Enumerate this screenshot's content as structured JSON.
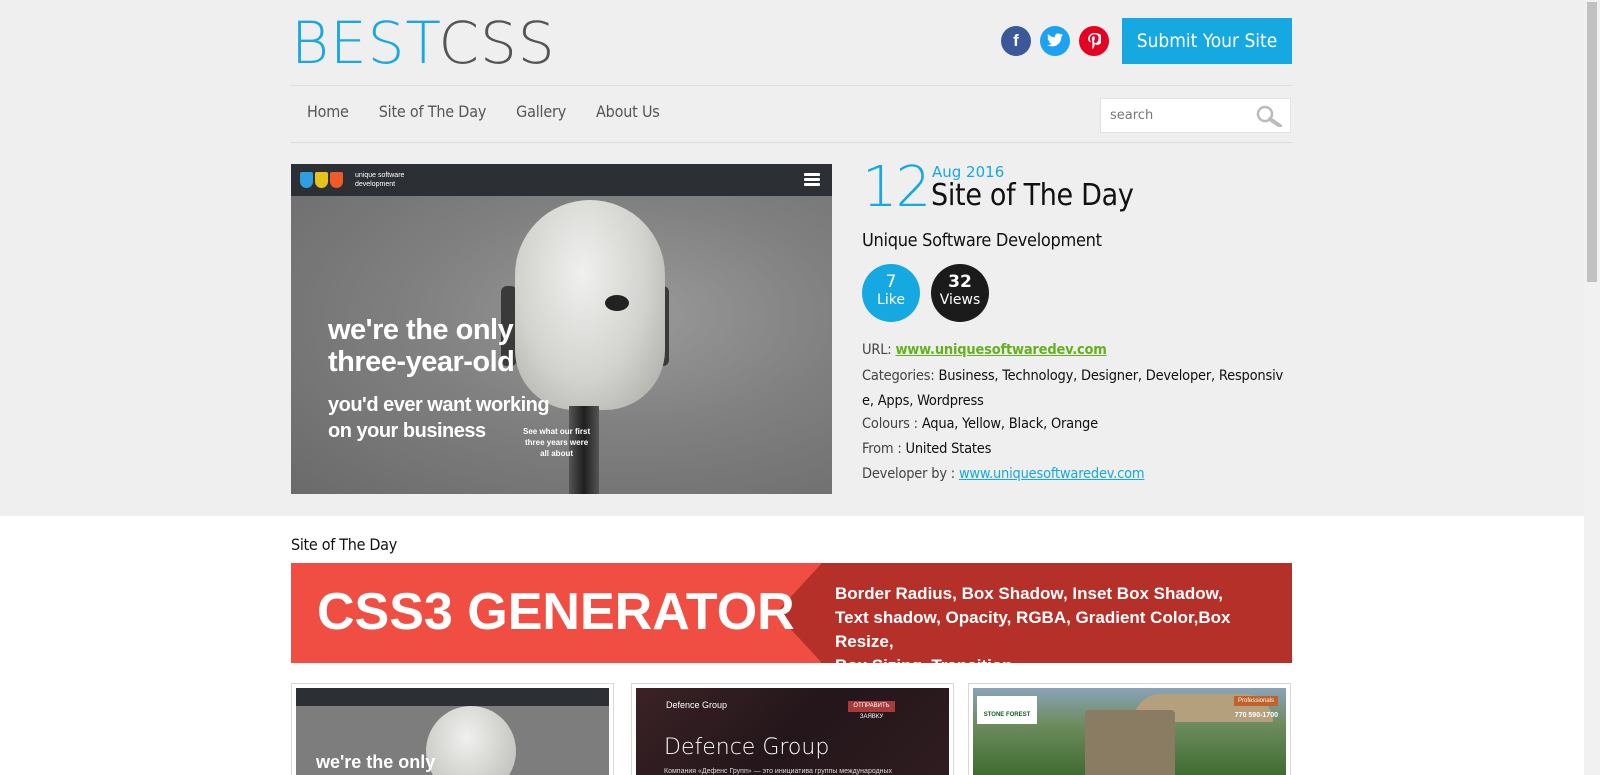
{
  "header": {
    "logo_best": "BEST",
    "logo_css": "CSS",
    "submit_label": "Submit Your Site",
    "social": [
      {
        "name": "facebook",
        "glyph": "f"
      },
      {
        "name": "twitter",
        "glyph": ""
      },
      {
        "name": "pinterest",
        "glyph": ""
      }
    ]
  },
  "nav": {
    "items": [
      "Home",
      "Site of The Day",
      "Gallery",
      "About Us"
    ],
    "search_placeholder": "search"
  },
  "featured": {
    "day": "12",
    "month_year": "Aug 2016",
    "heading": "Site of The Day",
    "site_name": "Unique Software Development",
    "likes_count": "7",
    "likes_label": "Like",
    "views_count": "32",
    "views_label": "Views",
    "url_label": "URL:",
    "url": "www.uniquesoftwaredev.com",
    "categories_label": "Categories:",
    "categories": "Business, Technology, Designer, Developer, Responsive, Apps, Wordpress",
    "colours_label": "Colours :",
    "colours": "Aqua, Yellow, Black, Orange",
    "from_label": "From :",
    "from": "United States",
    "developer_label": "Developer by :",
    "developer": "www.uniquesoftwaredev.com",
    "screenshot": {
      "brand_text_line1": "unique software",
      "brand_text_line2": "development",
      "headline_line1": "we're the only",
      "headline_line2": "three-year-old",
      "sub_line1": "you'd ever want working",
      "sub_line2": "on your business",
      "caption_line1": "See what our first",
      "caption_line2": "three years were",
      "caption_line3": "all about"
    }
  },
  "section": {
    "title": "Site of The Day"
  },
  "banner": {
    "big": "CSS3 GENERATOR",
    "line1": "Border Radius, Box Shadow, Inset Box Shadow,",
    "line2": "Text shadow, Opacity, RGBA, Gradient Color,Box Resize,",
    "line3": "Box Sizing, Transition"
  },
  "thumbs": [
    {
      "text": "we're the only"
    },
    {
      "logo": "Defence Group",
      "title": "Defence Group",
      "button": "ОТПРАВИТЬ ЗАЯВКУ",
      "sub": "Компания «Дефенс Групп» — это инициатива группы международных"
    },
    {
      "logo": "STONE FOREST",
      "phone": "770 590-1700",
      "badge": "Professionals"
    }
  ],
  "colors": {
    "accent": "#16a8e0",
    "url_green": "#64b01f",
    "banner_red": "#f04d43",
    "banner_dark_red": "#b43028"
  }
}
